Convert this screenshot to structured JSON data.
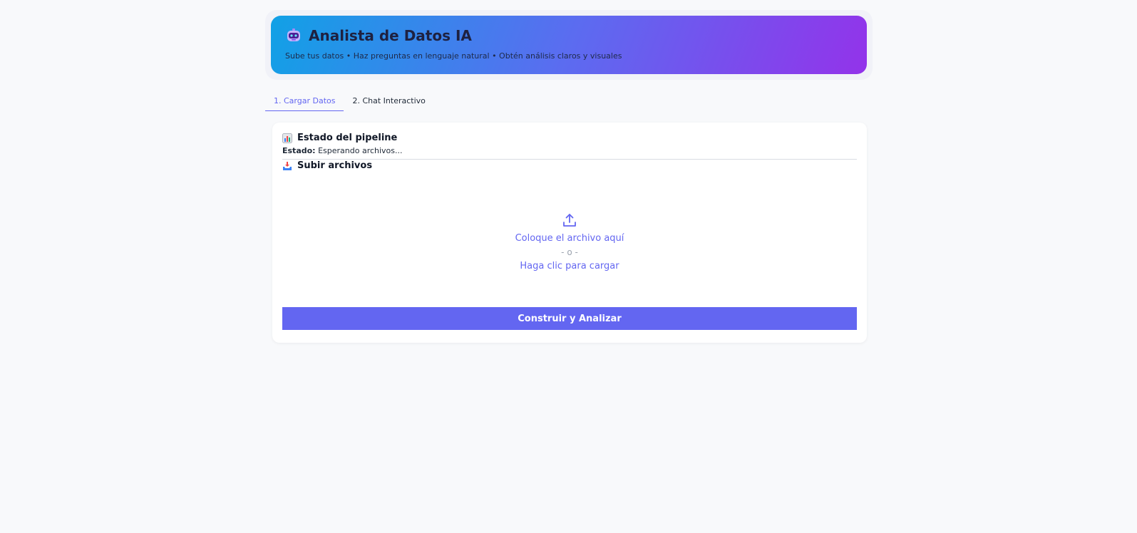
{
  "header": {
    "title": "Analista de Datos IA",
    "subtitle": "Sube tus datos • Haz preguntas en lenguaje natural • Obtén análisis claros y visuales",
    "icon": "robot-icon"
  },
  "tabs": [
    {
      "label": "1. Cargar Datos",
      "active": true
    },
    {
      "label": "2. Chat Interactivo",
      "active": false
    }
  ],
  "pipeline": {
    "title": "Estado del pipeline",
    "icon": "bar-chart-icon",
    "status_label": "Estado:",
    "status_value": "Esperando archivos..."
  },
  "upload": {
    "title": "Subir archivos",
    "icon": "inbox-tray-icon",
    "drop_text": "Coloque el archivo aquí",
    "or_text": "- o -",
    "click_text": "Haga clic para cargar"
  },
  "actions": {
    "build_label": "Construir y Analizar"
  },
  "colors": {
    "accent": "#6366f1",
    "gradient_start": "#11a1e6",
    "gradient_end": "#9333ea",
    "background": "#f8f9fb"
  }
}
